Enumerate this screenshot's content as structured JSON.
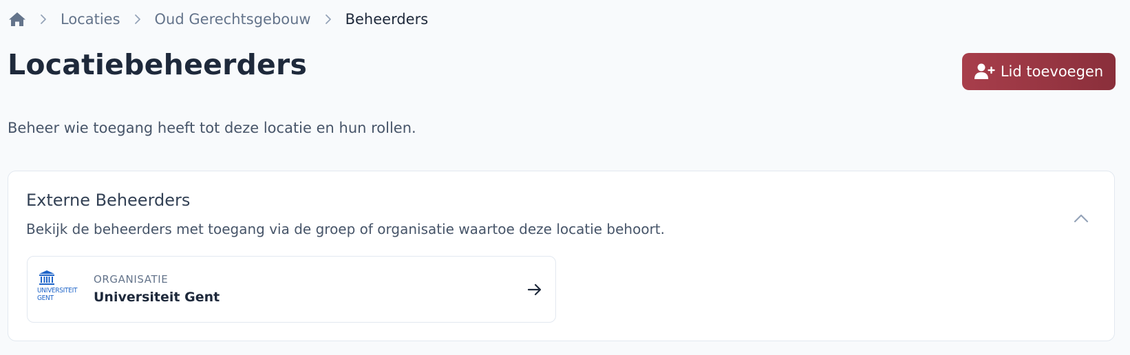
{
  "breadcrumb": {
    "home_icon": "home-icon",
    "items": [
      {
        "label": "Locaties"
      },
      {
        "label": "Oud Gerechtsgebouw"
      },
      {
        "label": "Beheerders"
      }
    ]
  },
  "header": {
    "title": "Locatiebeheerders",
    "add_button_label": "Lid toevoegen",
    "add_button_icon": "user-plus-icon",
    "subtitle": "Beheer wie toegang heeft tot deze locatie en hun rollen."
  },
  "external_admins": {
    "title": "Externe Beheerders",
    "description": "Bekijk de beheerders met toegang via de groep of organisatie waartoe deze locatie behoort.",
    "toggle_icon": "chevron-up-icon",
    "organization": {
      "type_label": "ORGANISATIE",
      "name": "Universiteit Gent",
      "logo_text": "UNIVERSITEIT\nGENT",
      "logo_color": "#1e64c8",
      "arrow_icon": "arrow-right-icon"
    }
  },
  "colors": {
    "background": "#f8fafc",
    "accent": "#a83e4b",
    "text": "#1e293b",
    "muted": "#64748b"
  }
}
